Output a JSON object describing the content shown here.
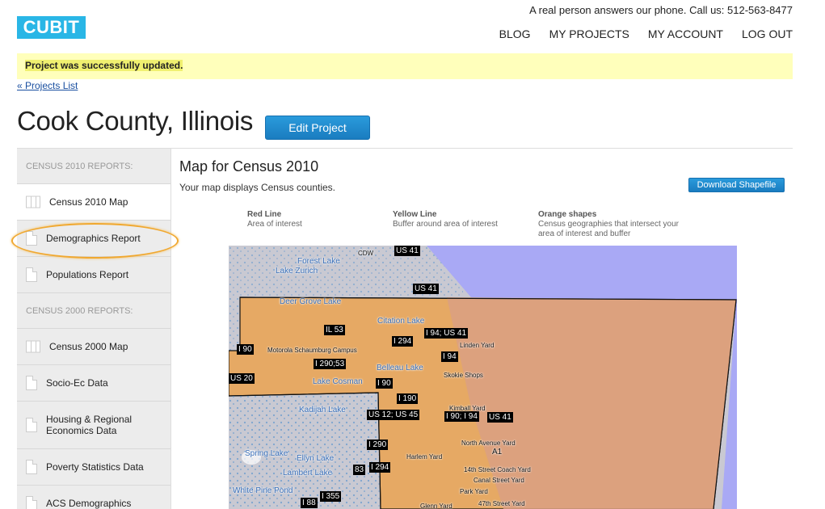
{
  "header": {
    "logo": "CUBIT",
    "phone_text": "A real person answers our phone. Call us: 512-563-8477",
    "nav": [
      "BLOG",
      "MY PROJECTS",
      "MY ACCOUNT",
      "LOG OUT"
    ]
  },
  "flash": {
    "message": "Project was successfully updated."
  },
  "back_link": "« Projects List",
  "page": {
    "title": "Cook County, Illinois",
    "edit_button": "Edit Project"
  },
  "sidebar": {
    "items": [
      {
        "type": "heading",
        "label": "CENSUS 2010 REPORTS:"
      },
      {
        "type": "link",
        "label": "Census 2010 Map",
        "icon": "map-icon",
        "active": true
      },
      {
        "type": "link",
        "label": "Demographics Report",
        "icon": "document-icon"
      },
      {
        "type": "link",
        "label": "Populations Report",
        "icon": "document-icon"
      },
      {
        "type": "heading",
        "label": "CENSUS 2000 REPORTS:"
      },
      {
        "type": "link",
        "label": "Census 2000 Map",
        "icon": "map-icon"
      },
      {
        "type": "link",
        "label": "Socio-Ec Data",
        "icon": "document-icon"
      },
      {
        "type": "link",
        "label": "Housing & Regional Economics Data",
        "icon": "document-icon"
      },
      {
        "type": "link",
        "label": "Poverty Statistics Data",
        "icon": "document-icon"
      },
      {
        "type": "link",
        "label": "ACS Demographics",
        "icon": "document-icon"
      }
    ]
  },
  "main": {
    "title": "Map for Census 2010",
    "subtitle": "Your map displays Census counties.",
    "download_button": "Download Shapefile",
    "legend": [
      {
        "title": "Red Line",
        "text": "Area of interest"
      },
      {
        "title": "Yellow Line",
        "text": "Buffer around area of interest"
      },
      {
        "title": "Orange shapes",
        "text": "Census geographies that intersect your area of interest and buffer"
      }
    ]
  },
  "map": {
    "shields": [
      "US 41",
      "US 41",
      "IL 53",
      "I 94; US 41",
      "I 294",
      "I 90",
      "I 94",
      "I 290;53",
      "US 20",
      "I 90",
      "I 190",
      "US 12; US 45",
      "I 90; I 94",
      "US 41",
      "I 290",
      "I 294",
      "I 355",
      "I 88",
      "83"
    ],
    "water": [
      "Forest Lake",
      "Lake Zurich",
      "Deer Grove Lake",
      "Citation Lake",
      "Belleau Lake",
      "Lake Cosman",
      "Kadijah Lake",
      "Spring Lake",
      "Ellyn Lake",
      "Lambert Lake",
      "White Pine Pond"
    ],
    "places": [
      "CDW",
      "Motorola Schaumburg Campus",
      "Linden Yard",
      "Skokie Shops",
      "Kimball Yard",
      "North Avenue Yard",
      "Harlem Yard",
      "14th Street Coach Yard",
      "Canal Street Yard",
      "Park Yard",
      "Glenn Yard",
      "47th Street Yard",
      "A1"
    ],
    "colors": {
      "land": "#c9c9d2",
      "lake": "#a9a9f5",
      "county_fill": "#e6a964",
      "county_east": "#d9a083",
      "water_dots": "#7fa6cf"
    }
  }
}
